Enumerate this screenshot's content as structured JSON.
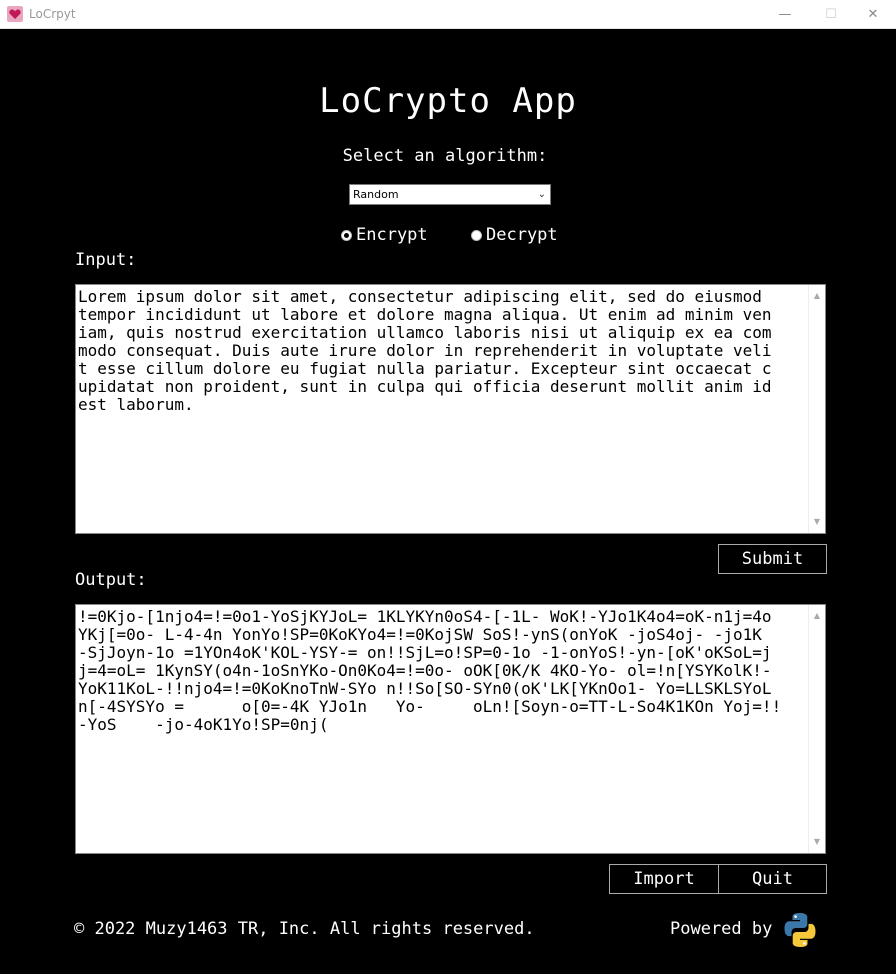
{
  "window": {
    "title": "LoCrpyt",
    "minimize": "—",
    "maximize": "☐",
    "close": "✕"
  },
  "app": {
    "title": "LoCrypto App",
    "select_label": "Select an algorithm:",
    "algorithm_selected": "Random",
    "mode_options": [
      "Encrypt",
      "Decrypt"
    ],
    "mode_selected": "Encrypt"
  },
  "input": {
    "label": "Input:",
    "text": "Lorem ipsum dolor sit amet, consectetur adipiscing elit, sed do eiusmod \ntempor incididunt ut labore et dolore magna aliqua. Ut enim ad minim ven\niam, quis nostrud exercitation ullamco laboris nisi ut aliquip ex ea com\nmodo consequat. Duis aute irure dolor in reprehenderit in voluptate veli\nt esse cillum dolore eu fugiat nulla pariatur. Excepteur sint occaecat c\nupidatat non proident, sunt in culpa qui officia deserunt mollit anim id\nest laborum."
  },
  "buttons": {
    "submit": "Submit",
    "import": "Import",
    "quit": "Quit"
  },
  "output": {
    "label": "Output:",
    "text": "!=0Kjo-[1njo4=!=0o1-YoSjKYJoL= 1KLYKYn0oS4-[-1L- WoK!-YJo1K4o4=oK-n1j=4o\nYKj[=0o- L-4-4n YonYo!SP=0KoKYo4=!=0KojSW SoS!-ynS(onYoK -joS4oj- -jo1K \n-SjJoyn-1o =1YOn4oK'KOL-YSY-= on!!SjL=o!SP=0-1o -1-onYoS!-yn-[oK'oKSoL=j\nj=4=oL= 1KynSY(o4n-1oSnYKo-On0Ko4=!=0o- oOK[0K/K 4KO-Yo- ol=!n[YSYKolK!-\nYoK11KoL-!!njo4=!=0KoKnoTnW-SYo n!!So[SO-SYn0(oK'LK[YKnOo1- Yo=LLSKLSYoL\nn[-4SYSYo =      o[0=-4K YJo1n   Yo-     oLn![Soyn-o=TT-L-So4K1KOn Yoj=!!\n-YoS    -jo-4oK1Yo!SP=0nj("
  },
  "footer": {
    "copyright": "© 2022 Muzy1463 TR, Inc. All rights reserved.",
    "powered_by": "Powered by"
  }
}
